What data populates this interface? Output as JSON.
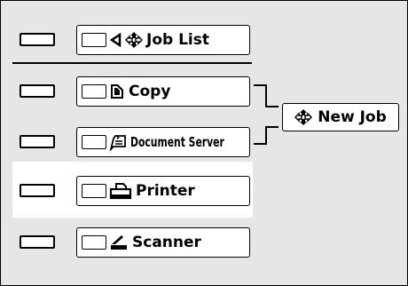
{
  "panel": {
    "rows": [
      {
        "key": "job_list",
        "label": "Job List",
        "icons": [
          "back-arrow-icon",
          "job-arrows-icon"
        ]
      },
      {
        "key": "copy",
        "label": "Copy",
        "icons": [
          "copy-icon"
        ]
      },
      {
        "key": "document_server",
        "label": "Document Server",
        "icons": [
          "document-server-icon"
        ]
      },
      {
        "key": "printer",
        "label": "Printer",
        "icons": [
          "printer-icon"
        ],
        "selected": true
      },
      {
        "key": "scanner",
        "label": "Scanner",
        "icons": [
          "scanner-icon"
        ]
      }
    ],
    "new_job": {
      "label": "New Job",
      "icon": "job-arrows-icon"
    }
  },
  "colors": {
    "panel_bg": "#e6e6e6",
    "highlight": "#ffffff",
    "outline": "#000000"
  }
}
